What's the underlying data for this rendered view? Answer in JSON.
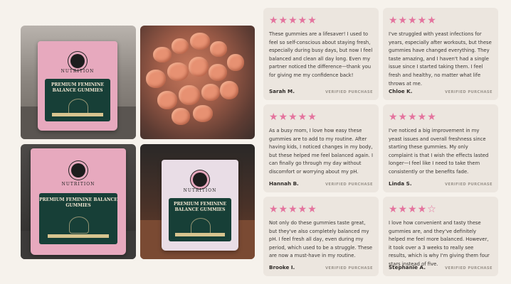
{
  "product": {
    "brand": "NUTRITION",
    "name": "PREMIUM FEMININE BALANCE GUMMIES"
  },
  "colors": {
    "page_bg": "#f6f2ec",
    "card_bg": "#ece6df",
    "star": "#e4749e",
    "pouch_pink": "#e7a9be",
    "label_green": "#173f37"
  },
  "reviews": [
    {
      "rating": 5,
      "stars": "★★★★★",
      "text": "These gummies are a lifesaver! I used to feel so self-conscious about staying fresh, especially during busy days, but now I feel balanced and clean all day long. Even my partner noticed the difference—thank you for giving me my confidence back!",
      "author": "Sarah M.",
      "verified": "VERIFIED PURCHASE"
    },
    {
      "rating": 5,
      "stars": "★★★★★",
      "text": "I've struggled with yeast infections for years, especially after workouts, but these gummies have changed everything. They taste amazing, and I haven't had a single issue since I started taking them. I feel fresh and healthy, no matter what life throws at me.",
      "author": "Chloe K.",
      "verified": "VERIFIED PURCHASE"
    },
    {
      "rating": 5,
      "stars": "★★★★★",
      "text": "As a busy mom, I love how easy these gummies are to add to my routine. After having kids, I noticed changes in my body, but these helped me feel balanced again. I can finally go through my day without discomfort or worrying about my pH.",
      "author": "Hannah B.",
      "verified": "VERIFIED PURCHASE"
    },
    {
      "rating": 5,
      "stars": "★★★★★",
      "text": "I've noticed a big improvement in my yeast issues and overall freshness since starting these gummies. My only complaint is that I wish the effects lasted longer—I feel like I need to take them consistently or the benefits fade.",
      "author": "Linda S.",
      "verified": "VERIFIED PURCHASE"
    },
    {
      "rating": 5,
      "stars": "★★★★★",
      "text": "Not only do these gummies taste great, but they've also completely balanced my pH. I feel fresh all day, even during my period, which used to be a struggle. These are now a must-have in my routine.",
      "author": "Brooke I.",
      "verified": "VERIFIED PURCHASE"
    },
    {
      "rating": 4,
      "stars": "★★★★☆",
      "text": "I love how convenient and tasty these gummies are, and they've definitely helped me feel more balanced. However, it took over a 3 weeks to really see results, which is why I'm giving them four stars instead of five.",
      "author": "Stephanie A.",
      "verified": "VERIFIED PURCHASE"
    }
  ]
}
